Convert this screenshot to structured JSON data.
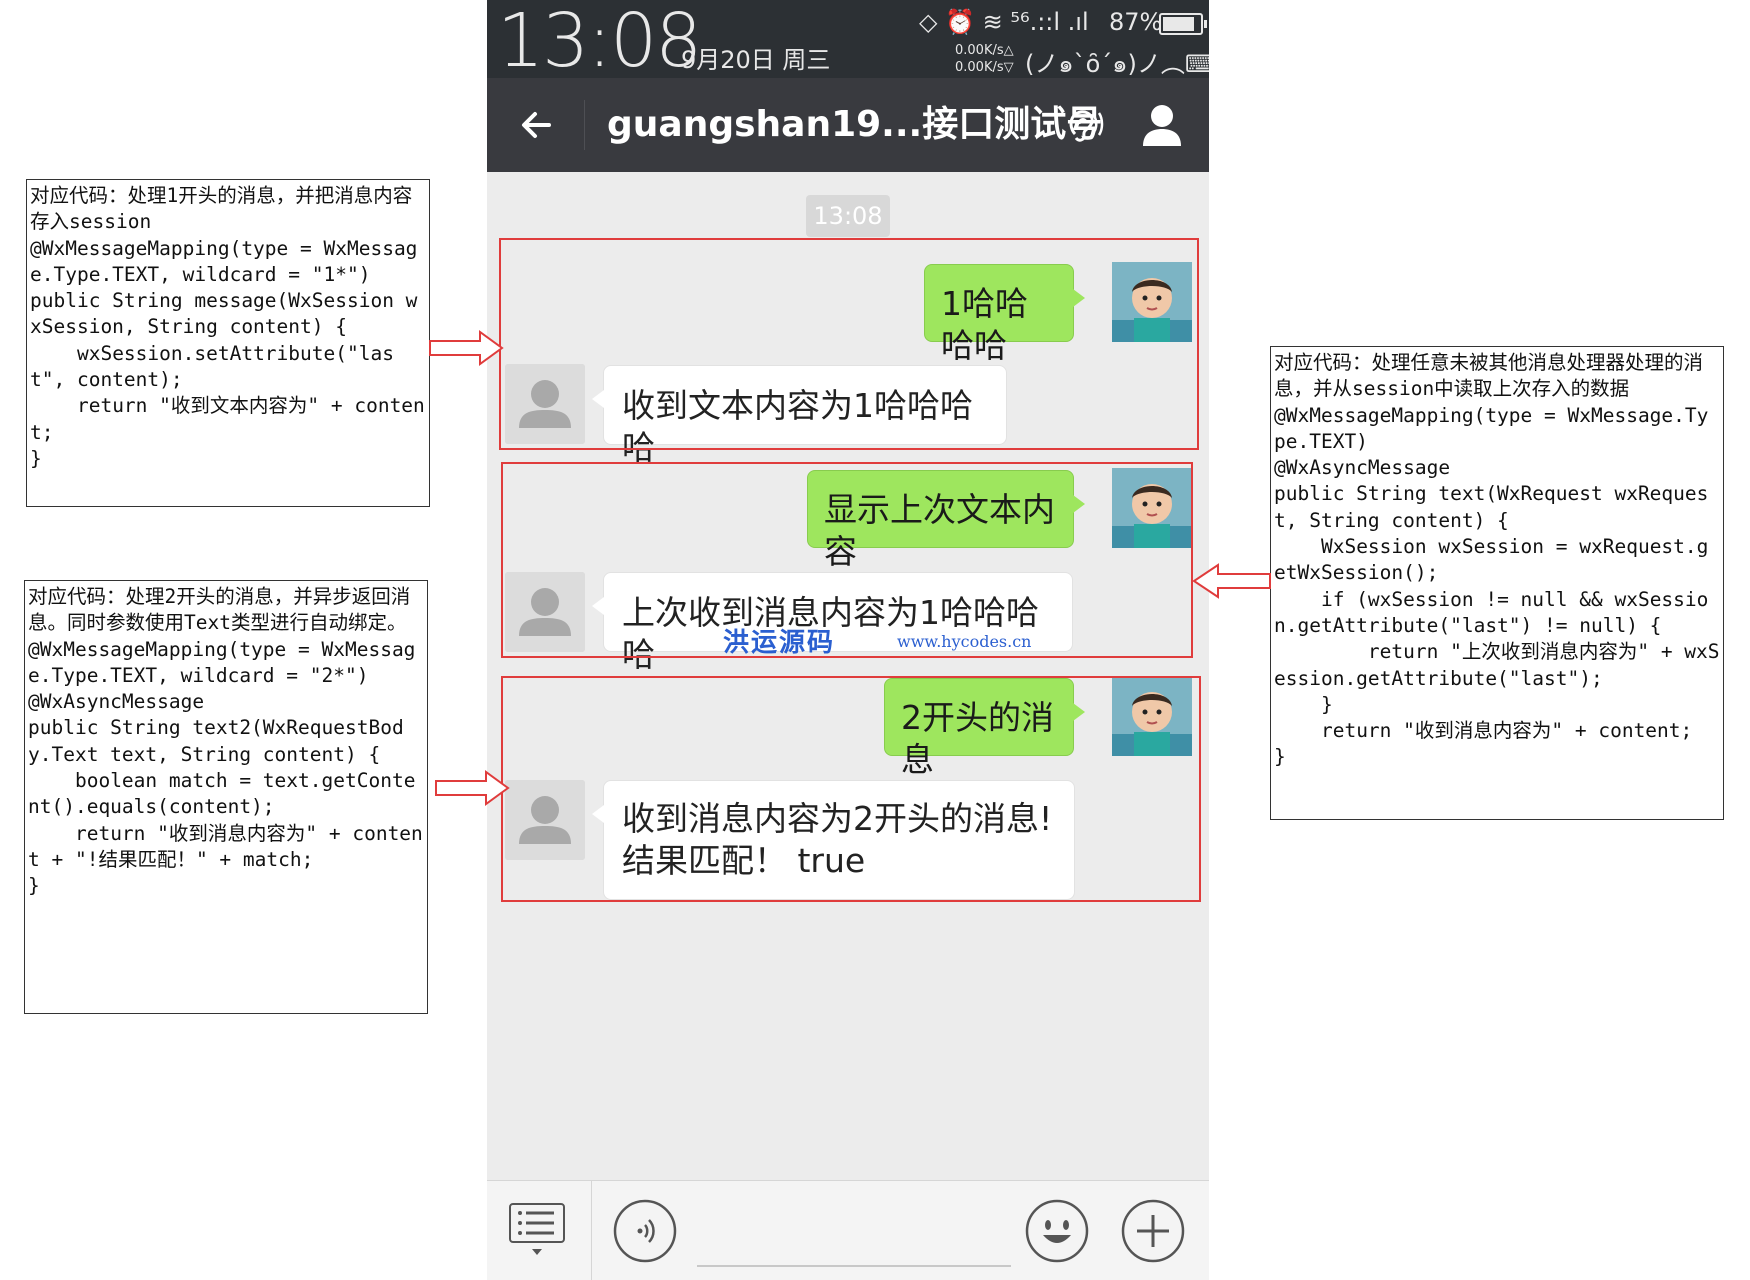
{
  "status_bar": {
    "time": "13:08",
    "date": "9月20日 周三",
    "signal_icons": "◇ ⏰ ≋ ⁵⁶.::l .ıl",
    "battery_percent": "87%",
    "battery_level": 0.87,
    "net_speed_up": "0.00K/s△",
    "net_speed_down": "0.00K/s▽",
    "kaomoji": "(ノ๑`ȏ´๑)ノ︵⌨"
  },
  "title_bar": {
    "title": "guangshan19...接口测试号"
  },
  "chat": {
    "timestamp": "13:08",
    "messages": [
      {
        "from": "me",
        "text": "1哈哈哈哈"
      },
      {
        "from": "them",
        "text": "收到文本内容为1哈哈哈哈"
      },
      {
        "from": "me",
        "text": "显示上次文本内容"
      },
      {
        "from": "them",
        "text": "上次收到消息内容为1哈哈哈哈"
      },
      {
        "from": "me",
        "text": "2开头的消息"
      },
      {
        "from": "them",
        "text": "收到消息内容为2开头的消息!结果匹配！ true"
      }
    ]
  },
  "watermark": {
    "cn": "洪运源码",
    "url": "www.hycodes.cn"
  },
  "annotations": [
    {
      "text": "对应代码：处理1开头的消息，并把消息内容存入session\n@WxMessageMapping(type = WxMessage.Type.TEXT, wildcard = \"1*\")\npublic String message(WxSession wxSession, String content) {\n    wxSession.setAttribute(\"last\", content);\n    return \"收到文本内容为\" + content;\n}"
    },
    {
      "text": "对应代码：处理2开头的消息，并异步返回消息。同时参数使用Text类型进行自动绑定。\n@WxMessageMapping(type = WxMessage.Type.TEXT, wildcard = \"2*\")\n@WxAsyncMessage\npublic String text2(WxRequestBody.Text text, String content) {\n    boolean match = text.getContent().equals(content);\n    return \"收到消息内容为\" + content + \"!结果匹配！\" + match;\n}"
    },
    {
      "text": "对应代码：处理任意未被其他消息处理器处理的消息，并从session中读取上次存入的数据\n@WxMessageMapping(type = WxMessage.Type.TEXT)\n@WxAsyncMessage\npublic String text(WxRequest wxRequest, String content) {\n    WxSession wxSession = wxRequest.getWxSession();\n    if (wxSession != null && wxSession.getAttribute(\"last\") != null) {\n        return \"上次收到消息内容为\" + wxSession.getAttribute(\"last\");\n    }\n    return \"收到消息内容为\" + content;\n}"
    }
  ],
  "colors": {
    "status_bar": "#2c3034",
    "title_bar": "#393a3f",
    "chat_bg": "#ececec",
    "bubble_me": "#9ee65e",
    "bubble_them": "#ffffff",
    "highlight": "#e03c3c",
    "watermark": "#2b5fd0"
  }
}
